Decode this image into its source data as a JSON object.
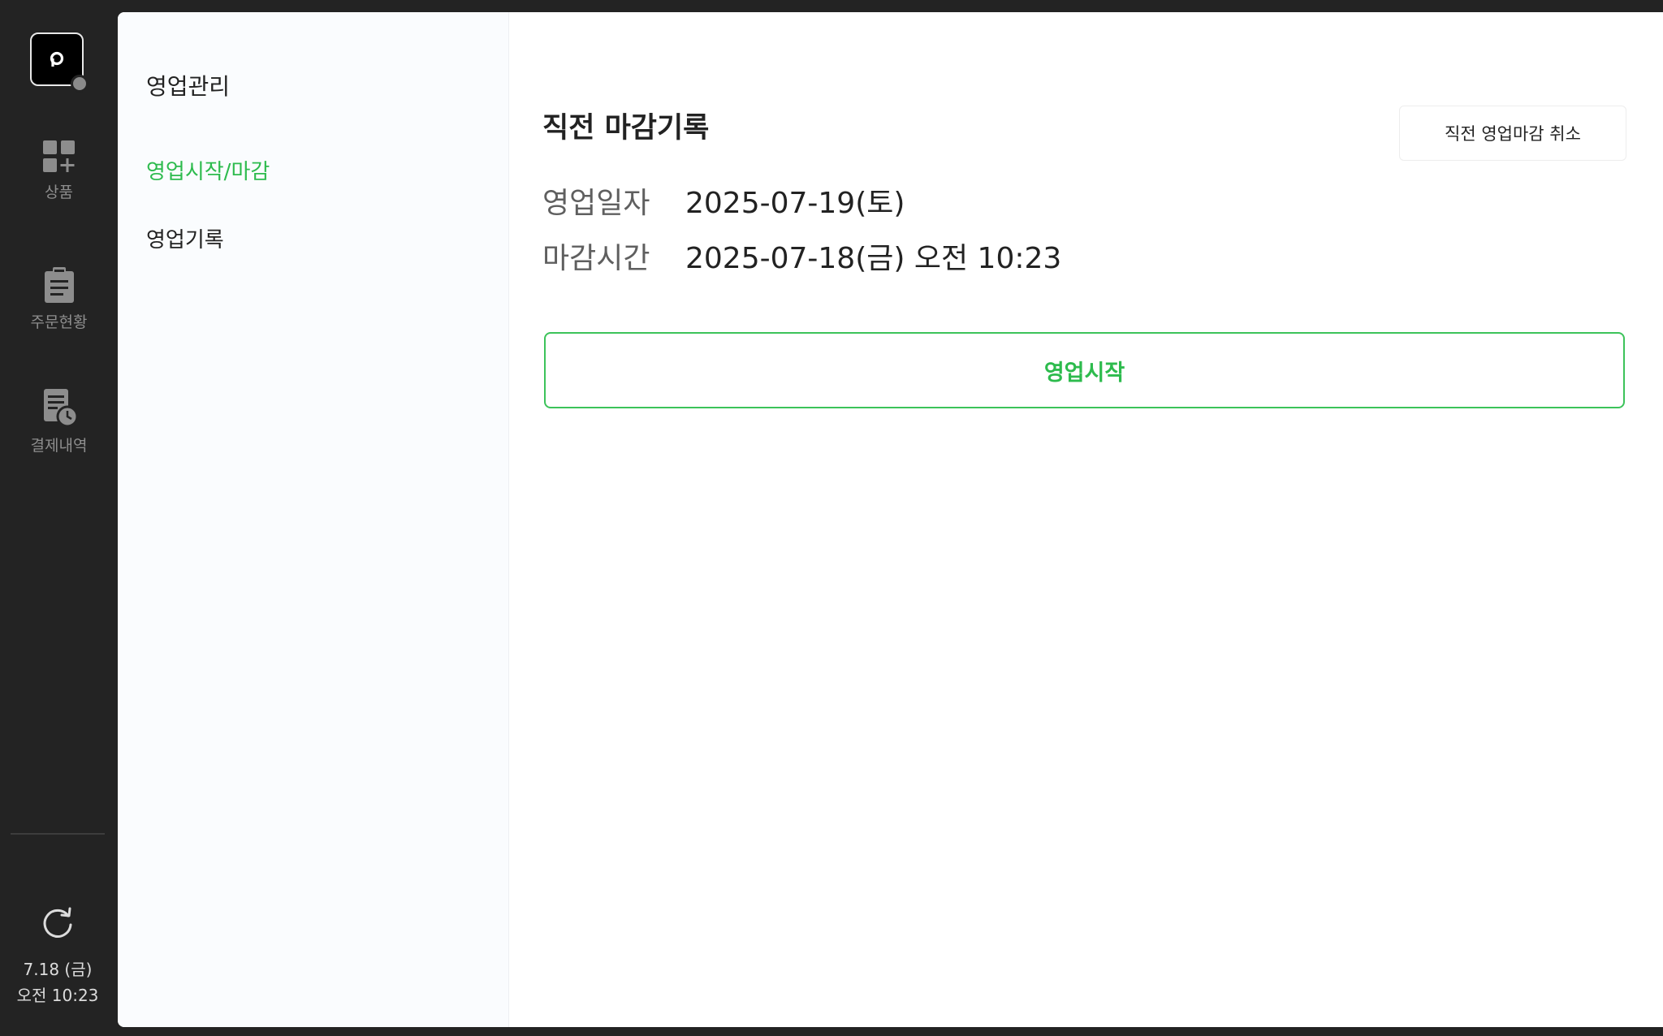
{
  "rail": {
    "logo_icon": "p-logo-icon",
    "status_color": "#8a8a8a",
    "items": [
      {
        "label": "상품",
        "icon": "grid-plus-icon"
      },
      {
        "label": "주문현황",
        "icon": "clipboard-icon"
      },
      {
        "label": "결제내역",
        "icon": "receipt-clock-icon"
      }
    ],
    "refresh_icon": "refresh-icon",
    "clock": {
      "date": "7.18 (금)",
      "time": "오전 10:23"
    }
  },
  "subnav": {
    "title": "영업관리",
    "items": [
      {
        "label": "영업시작/마감",
        "active": true
      },
      {
        "label": "영업기록",
        "active": false
      }
    ]
  },
  "main": {
    "title": "직전 마감기록",
    "cancel_label": "직전 영업마감 취소",
    "business_date_label": "영업일자",
    "business_date_value": "2025-07-19(토)",
    "close_time_label": "마감시간",
    "close_time_value": "2025-07-18(금) 오전 10:23",
    "start_label": "영업시작"
  },
  "colors": {
    "accent": "#2dbb4d",
    "rail_bg": "#232323",
    "subnav_bg": "#fafcfe"
  }
}
